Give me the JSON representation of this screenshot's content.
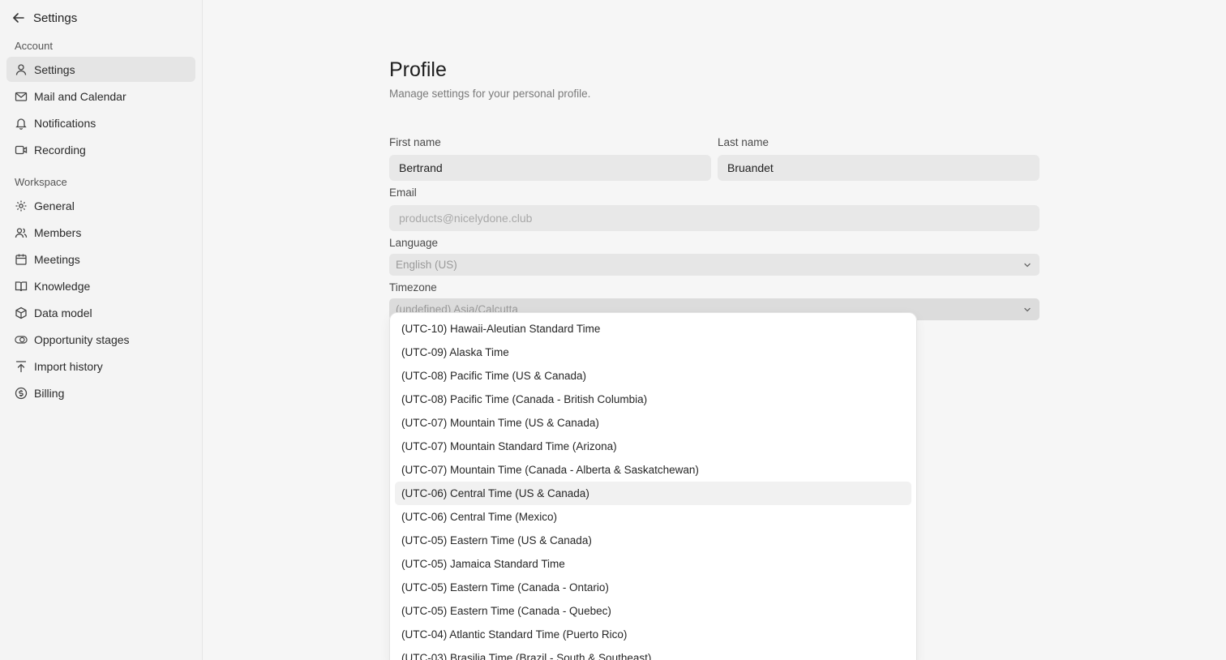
{
  "sidebar": {
    "header": {
      "title": "Settings"
    },
    "account_label": "Account",
    "account_items": [
      {
        "label": "Settings",
        "icon": "user-icon",
        "active": true
      },
      {
        "label": "Mail and Calendar",
        "icon": "mail-icon"
      },
      {
        "label": "Notifications",
        "icon": "bell-icon"
      },
      {
        "label": "Recording",
        "icon": "video-icon"
      }
    ],
    "workspace_label": "Workspace",
    "workspace_items": [
      {
        "label": "General",
        "icon": "gear-icon"
      },
      {
        "label": "Members",
        "icon": "users-icon"
      },
      {
        "label": "Meetings",
        "icon": "calendar-icon"
      },
      {
        "label": "Knowledge",
        "icon": "book-icon"
      },
      {
        "label": "Data model",
        "icon": "cube-icon"
      },
      {
        "label": "Opportunity stages",
        "icon": "toggle-circles-icon"
      },
      {
        "label": "Import history",
        "icon": "upload-icon"
      },
      {
        "label": "Billing",
        "icon": "dollar-circle-icon"
      }
    ]
  },
  "profile": {
    "title": "Profile",
    "subtitle": "Manage settings for your personal profile.",
    "first_name_label": "First name",
    "first_name_value": "Bertrand",
    "last_name_label": "Last name",
    "last_name_value": "Bruandet",
    "email_label": "Email",
    "email_placeholder": "products@nicelydone.club",
    "language_label": "Language",
    "language_value": "English (US)",
    "timezone_label": "Timezone",
    "timezone_value": "(undefined) Asia/Calcutta"
  },
  "timezone_options": [
    "(UTC-10) Hawaii-Aleutian Standard Time",
    "(UTC-09) Alaska Time",
    "(UTC-08) Pacific Time (US & Canada)",
    "(UTC-08) Pacific Time (Canada - British Columbia)",
    "(UTC-07) Mountain Time (US & Canada)",
    "(UTC-07) Mountain Standard Time (Arizona)",
    "(UTC-07) Mountain Time (Canada - Alberta & Saskatchewan)",
    "(UTC-06) Central Time (US & Canada)",
    "(UTC-06) Central Time (Mexico)",
    "(UTC-05) Eastern Time (US & Canada)",
    "(UTC-05) Jamaica Standard Time",
    "(UTC-05) Eastern Time (Canada - Ontario)",
    "(UTC-05) Eastern Time (Canada - Quebec)",
    "(UTC-04) Atlantic Standard Time (Puerto Rico)",
    "(UTC-03) Brasilia Time (Brazil - South & Southeast)"
  ],
  "hovered_option": "(UTC-06) Central Time (US & Canada)"
}
